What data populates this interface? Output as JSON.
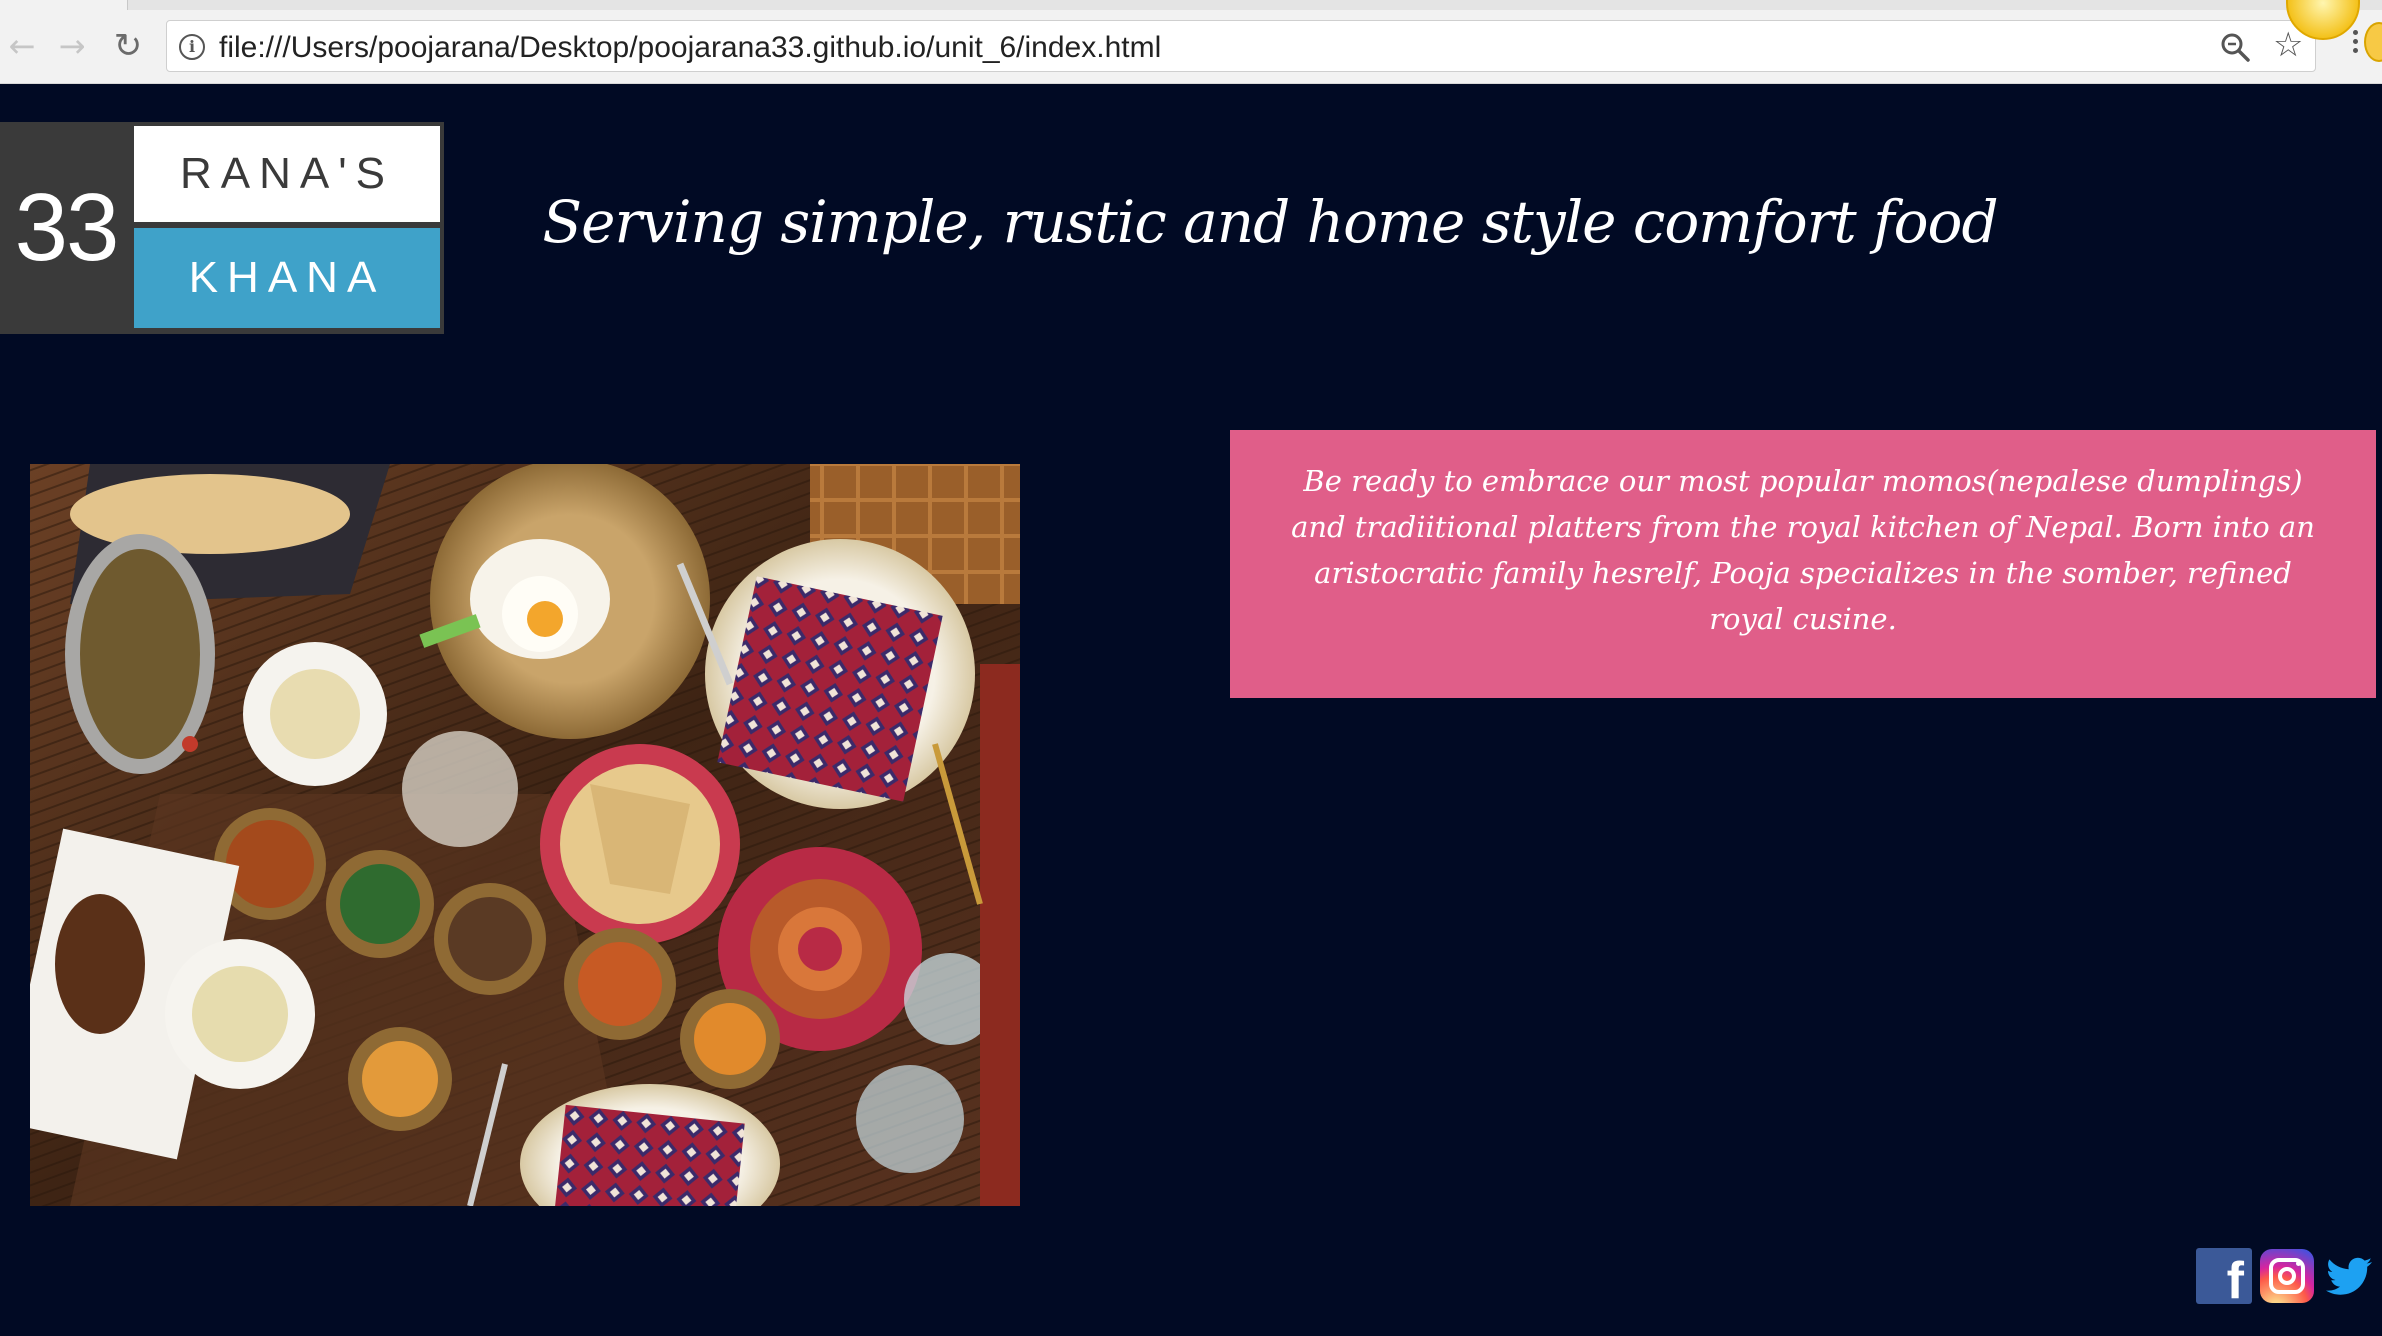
{
  "browser": {
    "url": "file:///Users/poojarana/Desktop/poojarana33.github.io/unit_6/index.html",
    "back_icon": "arrow-left-icon",
    "forward_icon": "arrow-right-icon",
    "reload_icon": "reload-icon",
    "info_icon": "info-icon",
    "zoom_icon": "zoom-icon",
    "bookmark_icon": "star-icon",
    "menu_icon": "kebab-menu-icon"
  },
  "logo": {
    "number": "33",
    "top_word": "RANA'S",
    "bottom_word": "KHANA"
  },
  "header": {
    "tagline": "Serving simple, rustic and home style comfort food"
  },
  "promo": {
    "text": "Be ready to embrace our most popular momos(nepalese dumplings) and tradiitional platters from the royal kitchen of Nepal. Born into an aristocratic family hesrelf, Pooja specializes in the somber, refined royal cusine."
  },
  "social": {
    "facebook_letter": "f",
    "icons": [
      "facebook-icon",
      "instagram-icon",
      "twitter-icon"
    ]
  },
  "colors": {
    "page_background": "#010a24",
    "promo_background": "#e05e89",
    "logo_accent": "#3fa2c9",
    "logo_dark": "#3a3a3a"
  }
}
